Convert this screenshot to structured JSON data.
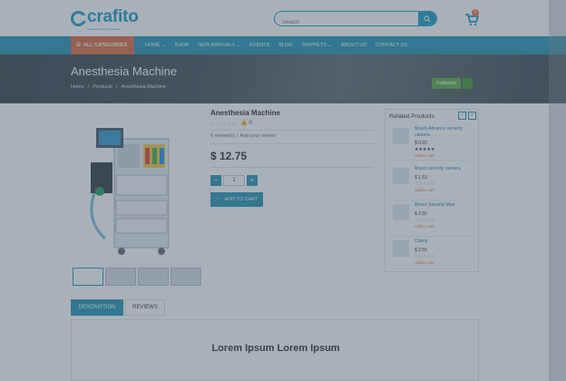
{
  "header": {
    "logo_text": "crafito",
    "logo_tagline": "responsive e-shop template",
    "search_placeholder": "Search",
    "cart_count": "0"
  },
  "nav": {
    "categories_label": "ALL CATEGORIES",
    "items": [
      "HOME ⌄",
      "SHOP",
      "NEW ARRIVALS ⌄",
      "EVENTS",
      "BLOG",
      "SNIPPETS ⌄",
      "ABOUT US",
      "CONTACT US"
    ]
  },
  "banner": {
    "title": "Anesthesia Machine",
    "breadcrumb": [
      "Home",
      "/",
      "Products",
      "/",
      "Anesthesia Machine"
    ],
    "status": "Published"
  },
  "product": {
    "name": "Anesthesia Machine",
    "stars": "☆☆☆☆☆",
    "likes": "0",
    "reviews": "0 review(s)",
    "add_review": "Add your review",
    "price": "$ 12.75",
    "qty_minus": "−",
    "qty": "1",
    "qty_plus": "+",
    "add_to_cart": "ADD TO CART"
  },
  "related": {
    "title": "Related Products",
    "items": [
      {
        "name": "Bosch Advance security camera",
        "price": "$ 0.02",
        "stars": "★★★★★",
        "add": "Add to cart"
      },
      {
        "name": "Bosch security camera",
        "price": "$ 1.53",
        "stars": "☆☆☆☆☆",
        "add": "Add to cart"
      },
      {
        "name": "Bosco Security Man",
        "price": "$ 2.55",
        "stars": "☆☆☆☆☆",
        "add": "Add to cart"
      },
      {
        "name": "Clamp",
        "price": "$ 2.55",
        "stars": "☆☆☆☆☆",
        "add": "Add to cart"
      }
    ]
  },
  "tabs": {
    "description": "DESCRIPTION",
    "reviews": "REVIEWS"
  },
  "description": {
    "heading": "Lorem Ipsum  Lorem Ipsum"
  },
  "colors": {
    "brand": "#1d9fc9",
    "nav": "#2a95b7",
    "accent": "#dd6c49",
    "status": "#5dae4b"
  }
}
